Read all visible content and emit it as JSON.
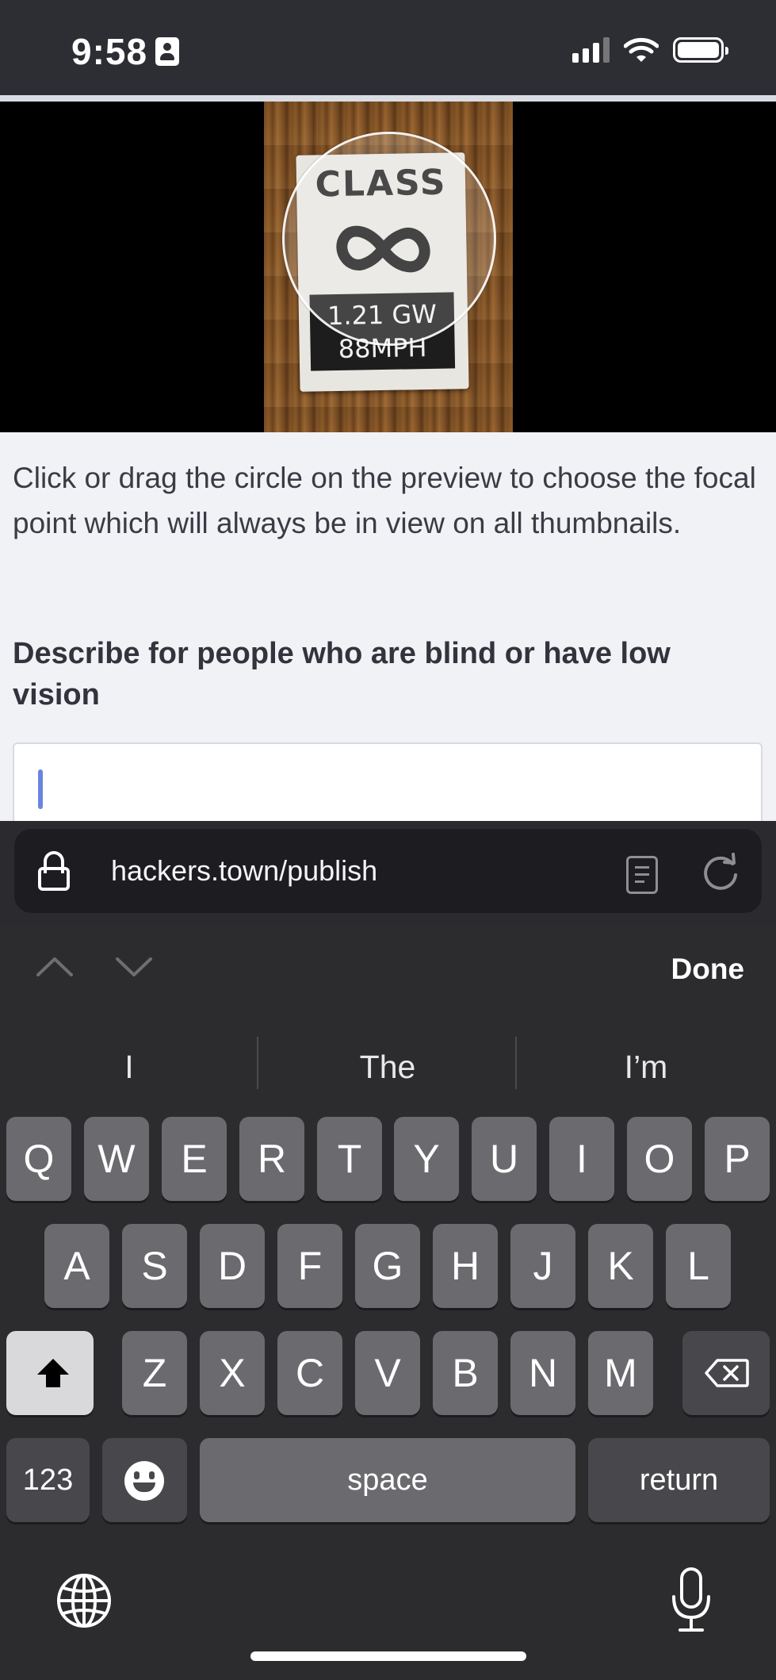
{
  "status_bar": {
    "time": "9:58"
  },
  "preview": {
    "sticker_title": "CLASS",
    "sticker_line1": "1.21 GW",
    "sticker_line2": "88MPH"
  },
  "hint_text": "Click or drag the circle on the preview to choose the focal point which will always be in view on all thumbnails.",
  "alt_text": {
    "heading": "Describe for people who are blind or have low vision",
    "value": ""
  },
  "browser": {
    "url": "hackers.town/publish"
  },
  "keyboard": {
    "done_label": "Done",
    "suggestions": [
      "I",
      "The",
      "I’m"
    ],
    "row1": [
      "Q",
      "W",
      "E",
      "R",
      "T",
      "Y",
      "U",
      "I",
      "O",
      "P"
    ],
    "row2": [
      "A",
      "S",
      "D",
      "F",
      "G",
      "H",
      "J",
      "K",
      "L"
    ],
    "row3": [
      "Z",
      "X",
      "C",
      "V",
      "B",
      "N",
      "M"
    ],
    "numbers_label": "123",
    "space_label": "space",
    "return_label": "return"
  },
  "icons": {
    "lock": "lock-icon",
    "reader": "reader-icon",
    "reload": "reload-icon",
    "shift": "shift-icon",
    "backspace": "backspace-icon",
    "emoji": "emoji-icon",
    "globe": "globe-icon",
    "mic": "microphone-icon"
  }
}
